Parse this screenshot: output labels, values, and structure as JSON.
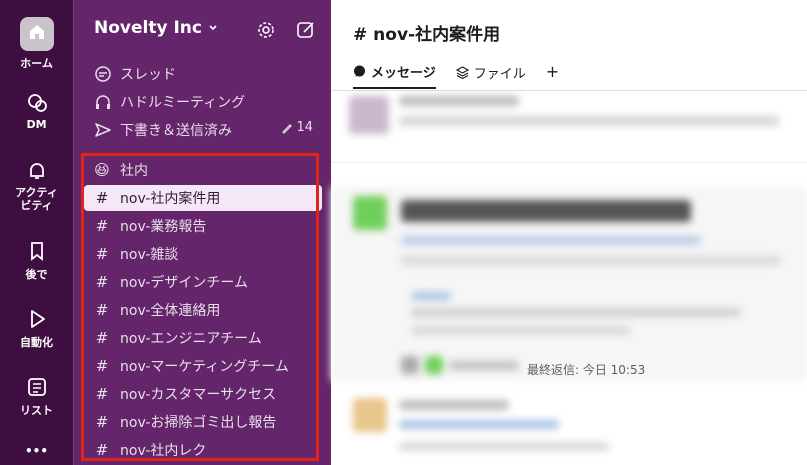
{
  "rail": {
    "home": "ホーム",
    "dm": "DM",
    "activity": "アクティ\nビティ",
    "later": "後で",
    "automation": "自動化",
    "lists": "リスト",
    "more": "•••"
  },
  "workspace": {
    "name": "Novelty Inc"
  },
  "nav": {
    "threads": "スレッド",
    "huddles": "ハドルミーティング",
    "drafts": "下書き＆送信済み",
    "drafts_count": "14"
  },
  "channels": [
    {
      "prefix": "😆",
      "name": "社内",
      "active": false
    },
    {
      "prefix": "#",
      "name": "nov-社内案件用",
      "active": true
    },
    {
      "prefix": "#",
      "name": "nov-業務報告",
      "active": false
    },
    {
      "prefix": "#",
      "name": "nov-雑談",
      "active": false
    },
    {
      "prefix": "#",
      "name": "nov-デザインチーム",
      "active": false
    },
    {
      "prefix": "#",
      "name": "nov-全体連絡用",
      "active": false
    },
    {
      "prefix": "#",
      "name": "nov-エンジニアチーム",
      "active": false
    },
    {
      "prefix": "#",
      "name": "nov-マーケティングチーム",
      "active": false
    },
    {
      "prefix": "#",
      "name": "nov-カスタマーサクセス",
      "active": false
    },
    {
      "prefix": "#",
      "name": "nov-お掃除ゴミ出し報告",
      "active": false
    },
    {
      "prefix": "#",
      "name": "nov-社内レク",
      "active": false
    }
  ],
  "channel_view": {
    "title": "# nov-社内案件用",
    "tabs": [
      "メッセージ",
      "ファイル",
      "+"
    ],
    "last_reply": "最終返信: 今日 10:53"
  },
  "colors": {
    "rail": "#3f0e40",
    "sidebar": "#64256a",
    "highlight": "#e0241b",
    "active_bg": "#f5e8f6"
  }
}
